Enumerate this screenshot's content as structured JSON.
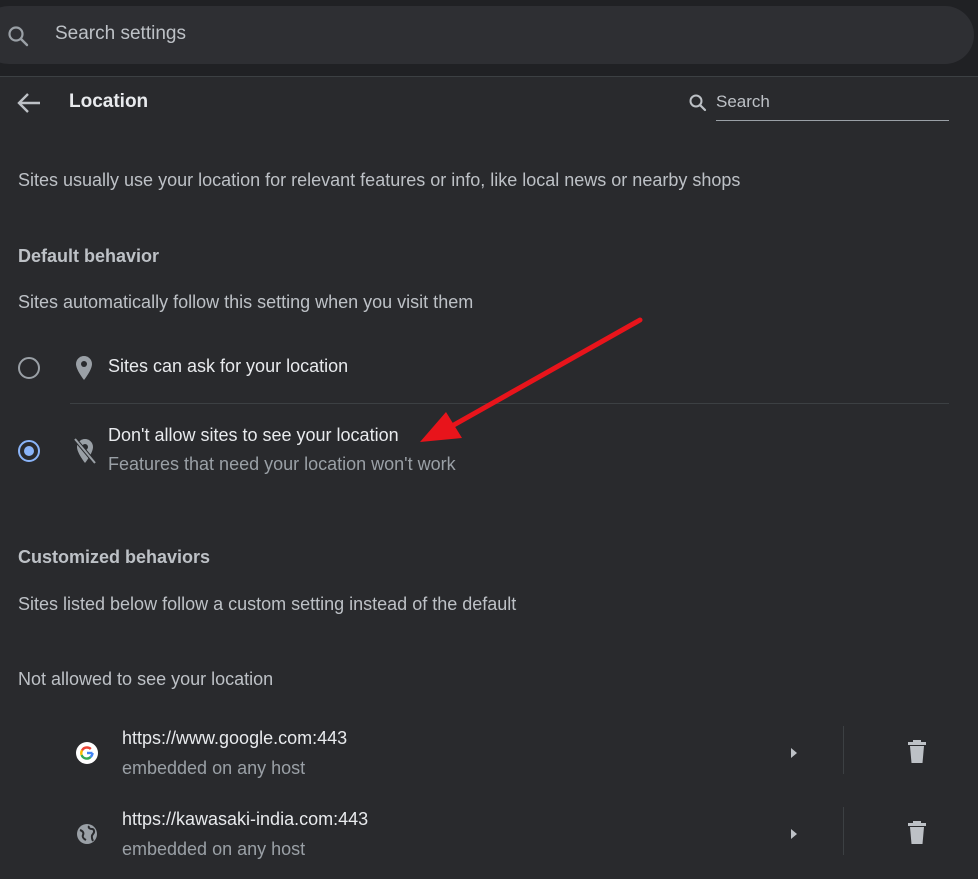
{
  "top_search": {
    "placeholder": "Search settings",
    "icon": "search-icon"
  },
  "header": {
    "title": "Location",
    "back_icon": "arrow-back-icon",
    "search_placeholder": "Search"
  },
  "intro": "Sites usually use your location for relevant features or info, like local news or nearby shops",
  "default_behavior": {
    "heading": "Default behavior",
    "description": "Sites automatically follow this setting when you visit them",
    "options": [
      {
        "label": "Sites can ask for your location",
        "icon": "location-pin-icon",
        "selected": false
      },
      {
        "label": "Don't allow sites to see your location",
        "sublabel": "Features that need your location won't work",
        "icon": "location-off-icon",
        "selected": true
      }
    ]
  },
  "customized": {
    "heading": "Customized behaviors",
    "description": "Sites listed below follow a custom setting instead of the default",
    "blocked_heading": "Not allowed to see your location",
    "sites": [
      {
        "url": "https://www.google.com:443",
        "sub": "embedded on any host",
        "icon": "google-g-icon"
      },
      {
        "url": "https://kawasaki-india.com:443",
        "sub": "embedded on any host",
        "icon": "globe-icon"
      }
    ]
  },
  "annotation": {
    "color": "#e8141b",
    "icon": "red-arrow-annotation"
  },
  "colors": {
    "accent": "#8ab4f8",
    "background": "#292a2d",
    "topbar": "#202124"
  }
}
